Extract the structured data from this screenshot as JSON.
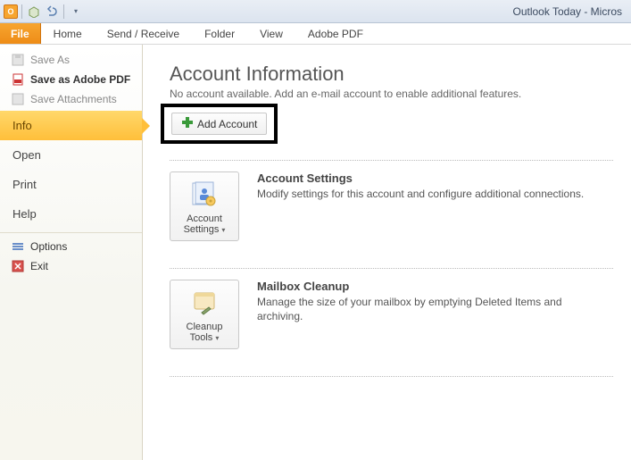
{
  "window": {
    "title": "Outlook Today - Micros"
  },
  "ribbon": {
    "file": "File",
    "tabs": [
      "Home",
      "Send / Receive",
      "Folder",
      "View",
      "Adobe PDF"
    ]
  },
  "sidebar": {
    "fileMenu": [
      {
        "label": "Save As",
        "enabled": false,
        "icon": "save-icon"
      },
      {
        "label": "Save as Adobe PDF",
        "enabled": true,
        "icon": "pdf-icon"
      },
      {
        "label": "Save Attachments",
        "enabled": false,
        "icon": "attach-icon"
      }
    ],
    "nav": [
      {
        "label": "Info",
        "selected": true
      },
      {
        "label": "Open",
        "selected": false
      },
      {
        "label": "Print",
        "selected": false
      },
      {
        "label": "Help",
        "selected": false
      }
    ],
    "footer": [
      {
        "label": "Options",
        "icon": "options-icon"
      },
      {
        "label": "Exit",
        "icon": "exit-icon"
      }
    ]
  },
  "content": {
    "heading": "Account Information",
    "subtext": "No account available. Add an e-mail account to enable additional features.",
    "addAccount": "Add Account",
    "sections": [
      {
        "buttonLabel": "Account Settings",
        "title": "Account Settings",
        "desc": "Modify settings for this account and configure additional connections."
      },
      {
        "buttonLabel": "Cleanup Tools",
        "title": "Mailbox Cleanup",
        "desc": "Manage the size of your mailbox by emptying Deleted Items and archiving."
      }
    ]
  }
}
